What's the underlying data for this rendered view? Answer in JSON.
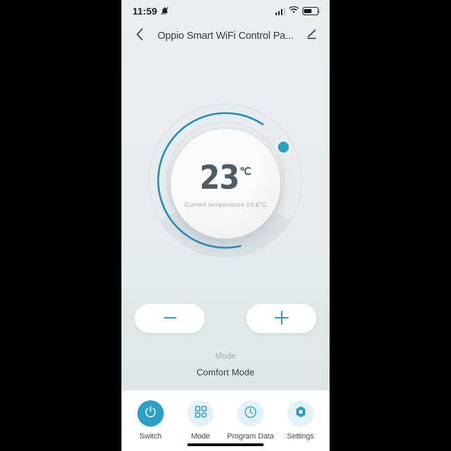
{
  "status_bar": {
    "time": "11:59",
    "mute_icon": "bell-muted-icon",
    "signal_icon": "cellular-signal-icon",
    "wifi_icon": "wifi-icon",
    "battery_icon": "battery-icon",
    "battery_level_percent": 60
  },
  "nav": {
    "back_icon": "chevron-left-icon",
    "title": "Oppio Smart WiFi Control Pa...",
    "edit_icon": "pencil-edit-icon"
  },
  "dial": {
    "target_temperature": "23",
    "unit": "℃",
    "current_temperature_text": "Current temperature 19.6°C",
    "arc_color": "#1b8fb5",
    "knob_color": "#2b9fc4",
    "track_color": "#e2e5e7",
    "arc_start_deg": 225,
    "arc_sweep_deg": 270,
    "arc_value_deg": 225
  },
  "stepper": {
    "minus_label": "−",
    "minus_icon": "minus-icon",
    "plus_label": "+",
    "plus_icon": "plus-icon",
    "icon_color": "#2b9fc4"
  },
  "mode": {
    "label": "Mode",
    "value": "Comfort  Mode"
  },
  "bottom_nav": {
    "items": [
      {
        "label": "Switch",
        "icon": "power-icon",
        "active": true
      },
      {
        "label": "Mode",
        "icon": "grid-icon",
        "active": false
      },
      {
        "label": "Program Data",
        "icon": "clock-icon",
        "active": false
      },
      {
        "label": "Settings",
        "icon": "hexagon-gear-icon",
        "active": false
      }
    ],
    "active_color": "#2b9fc4",
    "inactive_bg": "#e3f2f7"
  },
  "home_indicator": "home-indicator-bar"
}
